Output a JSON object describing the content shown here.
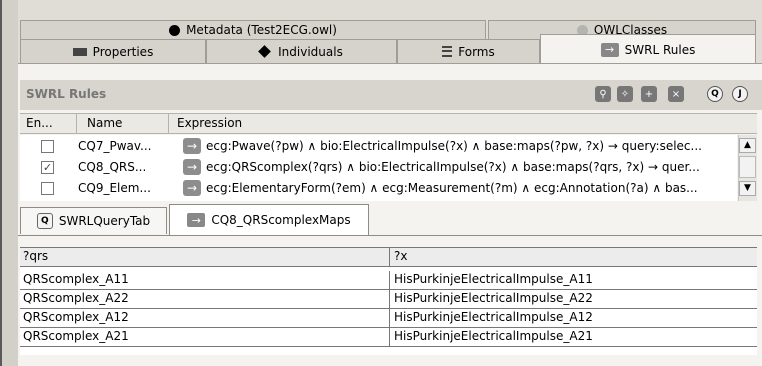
{
  "top_tabs": {
    "metadata": "Metadata (Test2ECG.owl)",
    "owlclasses": "OWLClasses"
  },
  "sub_tabs": {
    "properties": "Properties",
    "individuals": "Individuals",
    "forms": "Forms",
    "swrl_rules": "SWRL Rules"
  },
  "panel": {
    "title": "SWRL Rules",
    "toolbar": [
      "find-rule",
      "create-rule",
      "clone-rule",
      "delete-rule",
      "Q",
      "J"
    ],
    "q_label": "Q",
    "j_label": "J"
  },
  "rules_table": {
    "headers": {
      "enabled": "En...",
      "name": "Name",
      "expression": "Expression"
    },
    "rows": [
      {
        "enabled": false,
        "name": "CQ7_Pwav...",
        "arrow": "→",
        "expression": "ecg:Pwave(?pw) ∧ bio:ElectricalImpulse(?x) ∧ base:maps(?pw, ?x) → query:selec..."
      },
      {
        "enabled": true,
        "name": "CQ8_QRS...",
        "arrow": "→",
        "expression": "ecg:QRScomplex(?qrs) ∧ bio:ElectricalImpulse(?x) ∧ base:maps(?qrs, ?x) → quer..."
      },
      {
        "enabled": false,
        "name": "CQ9_Elem...",
        "arrow": "→",
        "expression": "ecg:ElementaryForm(?em) ∧ ecg:Measurement(?m) ∧ ecg:Annotation(?a) ∧ bas..."
      }
    ]
  },
  "query_tabs": {
    "query_tab": "SWRLQueryTab",
    "query_tab_icon": "Q",
    "result_tab": "CQ8_QRScomplexMaps",
    "result_tab_icon": "→"
  },
  "result_table": {
    "headers": [
      "?qrs",
      "?x"
    ],
    "rows": [
      [
        "QRScomplex_A11",
        "HisPurkinjeElectricalImpulse_A11"
      ],
      [
        "QRScomplex_A22",
        "HisPurkinjeElectricalImpulse_A22"
      ],
      [
        "QRScomplex_A12",
        "HisPurkinjeElectricalImpulse_A12"
      ],
      [
        "QRScomplex_A21",
        "HisPurkinjeElectricalImpulse_A21"
      ]
    ]
  }
}
